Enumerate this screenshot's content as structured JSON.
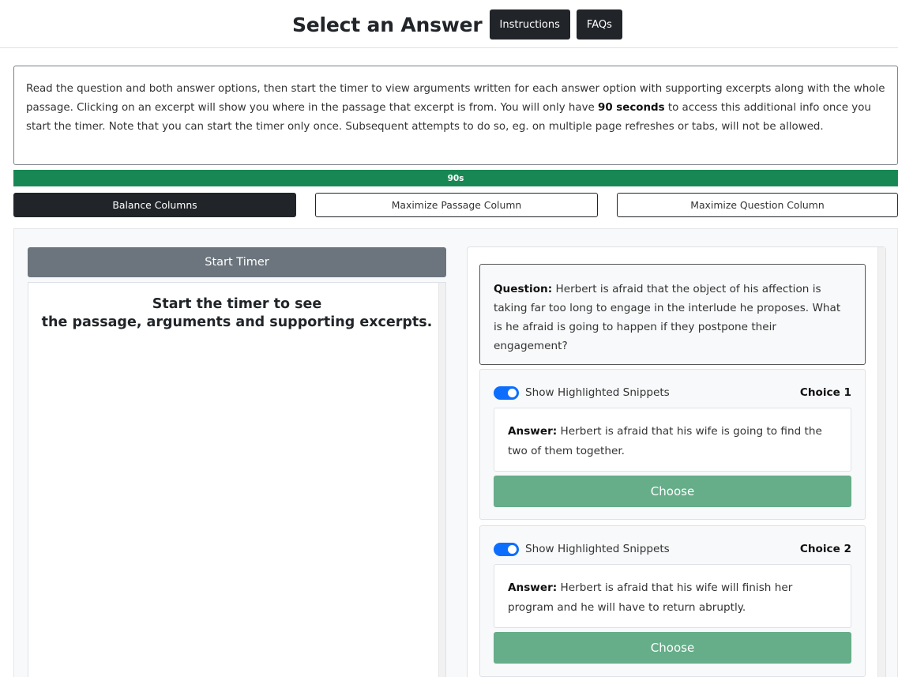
{
  "header": {
    "title": "Select an Answer",
    "instructions_label": "Instructions",
    "faqs_label": "FAQs"
  },
  "instructions": {
    "text_before": "Read the question and both answer options, then start the timer to view arguments written for each answer option with supporting excerpts along with the whole passage. Clicking on an excerpt will show you where in the passage that excerpt is from. You will only have ",
    "bold": "90 seconds",
    "text_after": " to access this additional info once you start the timer. Note that you can start the timer only once. Subsequent attempts to do so, eg. on multiple page refreshes or tabs, will not be allowed."
  },
  "timer": {
    "label": "90s",
    "fill_fraction": 1.0
  },
  "column_buttons": {
    "balance": "Balance Columns",
    "maximize_passage": "Maximize Passage Column",
    "maximize_question": "Maximize Question Column"
  },
  "passage": {
    "start_timer_label": "Start Timer",
    "message_line1": "Start the timer to see",
    "message_line2": "the passage, arguments and supporting excerpts."
  },
  "question": {
    "prefix": "Question:",
    "text": " Herbert is afraid that the object of his affection is taking far too long to engage in the interlude he proposes. What is he afraid is going to happen if they postpone their engagement?"
  },
  "choices": [
    {
      "toggle_label": "Show Highlighted Snippets",
      "toggle_on": true,
      "choice_label": "Choice 1",
      "answer_prefix": "Answer:",
      "answer_text": " Herbert is afraid that his wife is going to find the two of them together.",
      "choose_label": "Choose"
    },
    {
      "toggle_label": "Show Highlighted Snippets",
      "toggle_on": true,
      "choice_label": "Choice 2",
      "answer_prefix": "Answer:",
      "answer_text": " Herbert is afraid that his wife will finish her program and he will have to return abruptly.",
      "choose_label": "Choose"
    }
  ],
  "colors": {
    "dark": "#212529",
    "progress_green": "#198754",
    "choose_green": "#66ad89",
    "toggle_blue": "#0d6efd",
    "start_timer_gray": "#6c757d"
  }
}
